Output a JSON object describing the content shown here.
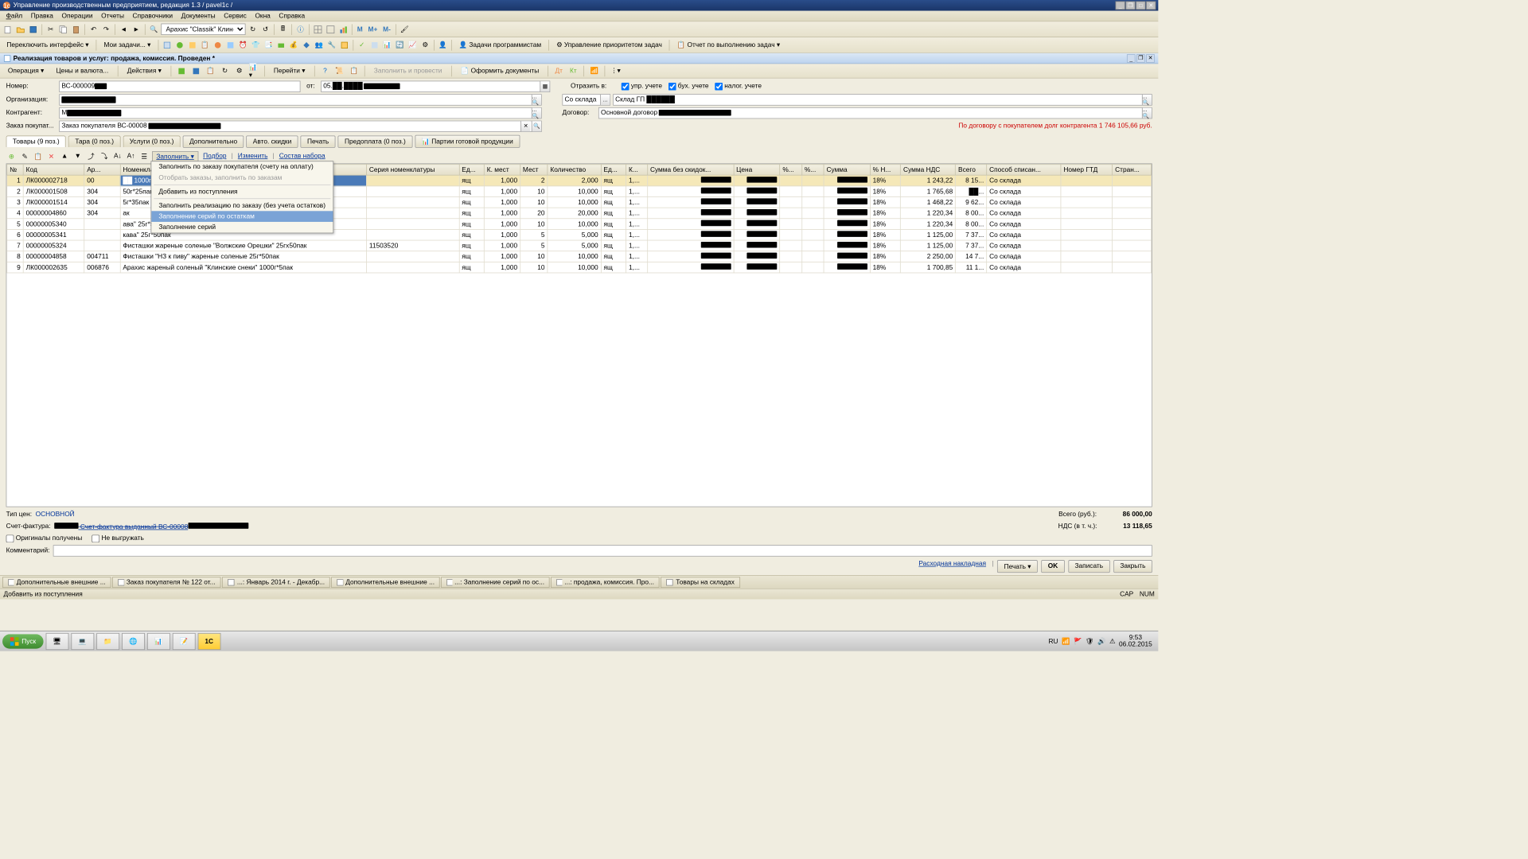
{
  "title": "Управление производственным предприятием, редакция 1.3 / pavel1c /",
  "menubar": [
    "Файл",
    "Правка",
    "Операции",
    "Отчеты",
    "Справочники",
    "Документы",
    "Сервис",
    "Окна",
    "Справка"
  ],
  "toolbar1": {
    "combo": "Арахис \"Classik\" Клинск▾"
  },
  "toolbar2": {
    "switch": "Переключить интерфейс ▾",
    "my": "Мои задачи... ▾",
    "task1": "Задачи программистам",
    "task2": "Управление приоритетом задач",
    "task3": "Отчет по выполнению задач ▾",
    "m": "M",
    "mplus": "M+",
    "mminus": "M-"
  },
  "doc": {
    "title": "Реализация товаров и услуг: продажа, комиссия. Проведен *"
  },
  "doctb": {
    "op": "Операция ▾",
    "prices": "Цены и валюта...",
    "actions": "Действия ▾",
    "go": "Перейти ▾",
    "fill": "Заполнить и провести",
    "format": "Оформить документы"
  },
  "form": {
    "label_number": "Номер:",
    "number": "ВС-000009",
    "label_from": "от:",
    "date": "05.██.████",
    "label_org": "Организация:",
    "label_counter": "Контрагент:",
    "label_order": "Заказ покупат...",
    "order": "Заказ покупателя ВС-00008",
    "label_reflect": "Отразить в:",
    "chk_upr": "упр. учете",
    "chk_buh": "бух. учете",
    "chk_nal": "налог. учете",
    "label_from_wh": "Со склада",
    "warehouse": "Склад ГП ██████",
    "label_contract": "Договор:",
    "contract": "Основной договор",
    "debt": "По договору с покупателем долг контрагента 1 746 105,66 руб."
  },
  "tabs": {
    "goods": "Товары (9 поз.)",
    "tara": "Тара (0 поз.)",
    "services": "Услуги (0 поз.)",
    "extra": "Дополнительно",
    "auto": "Авто. скидки",
    "print": "Печать",
    "prepay": "Предоплата (0 поз.)",
    "batch": "Партии готовой продукции"
  },
  "gridtb": {
    "fill": "Заполнить ▾",
    "pick": "Подбор",
    "edit": "Изменить",
    "compose": "Состав набора"
  },
  "dropdown": [
    {
      "t": "Заполнить по заказу покупателя (счету на оплату)"
    },
    {
      "t": "Отобрать заказы, заполнить по заказам",
      "disabled": true
    },
    {
      "sep": true
    },
    {
      "t": "Добавить из поступления"
    },
    {
      "sep": true
    },
    {
      "t": "Заполнить реализацию по заказу (без учета остатков)"
    },
    {
      "t": "Заполнение серий по остаткам",
      "sel": true
    },
    {
      "t": "Заполнение серий"
    }
  ],
  "columns": [
    "№",
    "Код",
    "Ар...",
    "Номенклатура",
    "Серия номенклатуры",
    "Ед...",
    "К. мест",
    "Мест",
    "Количество",
    "Ед...",
    "К...",
    "Сумма без скидок...",
    "Цена",
    "%...",
    "%...",
    "Сумма",
    "% Н...",
    "Сумма НДС",
    "Всего",
    "Способ списан...",
    "Номер ГТД",
    "Стран..."
  ],
  "rows": [
    {
      "n": 1,
      "code": "ЛК000002718",
      "art": "00",
      "nom": "██ 1000г*5пак",
      "ser": "",
      "ed": "ящ",
      "km": "1,000",
      "mest": "2",
      "qty": "2,000",
      "ed2": "ящ",
      "k": "1,...",
      "bezsk": "██",
      "price": "██",
      "sum": "██",
      "pn": "18%",
      "nds": "1 243,22",
      "all": "8 15...",
      "sp": "Со склада",
      "sel": true
    },
    {
      "n": 2,
      "code": "ЛК000001508",
      "art": "304",
      "nom": "50г*25пак",
      "ser": "",
      "ed": "ящ",
      "km": "1,000",
      "mest": "10",
      "qty": "10,000",
      "ed2": "ящ",
      "k": "1,...",
      "bezsk": "██",
      "price": "██",
      "sum": "██",
      "pn": "18%",
      "nds": "1 765,68",
      "all": "██...",
      "sp": "Со склада"
    },
    {
      "n": 3,
      "code": "ЛК000001514",
      "art": "304",
      "nom": "5г*35пак",
      "ser": "",
      "ed": "ящ",
      "km": "1,000",
      "mest": "10",
      "qty": "10,000",
      "ed2": "ящ",
      "k": "1,...",
      "bezsk": "██",
      "price": "██",
      "sum": "██",
      "pn": "18%",
      "nds": "1 468,22",
      "all": "9 62...",
      "sp": "Со склада"
    },
    {
      "n": 4,
      "code": "00000004860",
      "art": "304",
      "nom": "ак",
      "ser": "",
      "ed": "ящ",
      "km": "1,000",
      "mest": "20",
      "qty": "20,000",
      "ed2": "ящ",
      "k": "1,...",
      "bezsk": "██",
      "price": "██",
      "sum": "██",
      "pn": "18%",
      "nds": "1 220,34",
      "all": "8 00...",
      "sp": "Со склада"
    },
    {
      "n": 5,
      "code": "00000005340",
      "art": "",
      "nom": "ава\" 25г*50пак",
      "ser": "",
      "ed": "ящ",
      "km": "1,000",
      "mest": "10",
      "qty": "10,000",
      "ed2": "ящ",
      "k": "1,...",
      "bezsk": "██",
      "price": "██",
      "sum": "██",
      "pn": "18%",
      "nds": "1 220,34",
      "all": "8 00...",
      "sp": "Со склада"
    },
    {
      "n": 6,
      "code": "00000005341",
      "art": "",
      "nom": "кава\" 25г*50пак",
      "ser": "",
      "ed": "ящ",
      "km": "1,000",
      "mest": "5",
      "qty": "5,000",
      "ed2": "ящ",
      "k": "1,...",
      "bezsk": "██",
      "price": "██",
      "sum": "██",
      "pn": "18%",
      "nds": "1 125,00",
      "all": "7 37...",
      "sp": "Со склада"
    },
    {
      "n": 7,
      "code": "00000005324",
      "art": "",
      "nom": "Фисташки жареные соленые \"Волжские Орешки\" 25гх50пак",
      "ser": "11503520",
      "ed": "ящ",
      "km": "1,000",
      "mest": "5",
      "qty": "5,000",
      "ed2": "ящ",
      "k": "1,...",
      "bezsk": "██",
      "price": "██",
      "sum": "██",
      "pn": "18%",
      "nds": "1 125,00",
      "all": "7 37...",
      "sp": "Со склада"
    },
    {
      "n": 8,
      "code": "00000004858",
      "art": "004711",
      "nom": "Фисташки \"НЗ к пиву\" жареные соленые 25г*50пак",
      "ser": "",
      "ed": "ящ",
      "km": "1,000",
      "mest": "10",
      "qty": "10,000",
      "ed2": "ящ",
      "k": "1,...",
      "bezsk": "██",
      "price": "██",
      "sum": "██",
      "pn": "18%",
      "nds": "2 250,00",
      "all": "14 7...",
      "sp": "Со склада"
    },
    {
      "n": 9,
      "code": "ЛК000002635",
      "art": "006876",
      "nom": "Арахис жареный соленый \"Клинские снеки\" 1000г*5пак",
      "ser": "",
      "ed": "ящ",
      "km": "1,000",
      "mest": "10",
      "qty": "10,000",
      "ed2": "ящ",
      "k": "1,...",
      "bezsk": "██",
      "price": "██",
      "sum": "██",
      "pn": "18%",
      "nds": "1 700,85",
      "all": "11 1...",
      "sp": "Со склада"
    }
  ],
  "footer": {
    "pricetype_lbl": "Тип цен:",
    "pricetype": "ОСНОВНОЙ",
    "invoice_lbl": "Счет-фактура:",
    "invoice": "Счет-фактура выданный ВС-00008",
    "chk_orig": "Оригиналы получены",
    "chk_noexp": "Не выгружать",
    "comment_lbl": "Комментарий:",
    "total_lbl": "Всего (руб.):",
    "total": "86 000,00",
    "nds_lbl": "НДС (в т. ч.):",
    "nds": "13 118,65"
  },
  "botbtns": {
    "nakl": "Расходная накладная",
    "print": "Печать ▾",
    "ok": "OK",
    "save": "Записать",
    "close": "Закрыть"
  },
  "docbar": [
    "Дополнительные внешние ...",
    "Заказ покупателя № 122 от...",
    "...: Январь 2014 г. - Декабр...",
    "Дополнительные внешние ...",
    "...: Заполнение серий по ос...",
    "...: продажа, комиссия. Про...",
    "Товары на складах"
  ],
  "statusbar": {
    "hint": "Добавить из поступления",
    "cap": "CAP",
    "num": "NUM"
  },
  "wintb": {
    "start": "Пуск",
    "lang": "RU",
    "time": "9:53",
    "date": "06.02.2015"
  }
}
